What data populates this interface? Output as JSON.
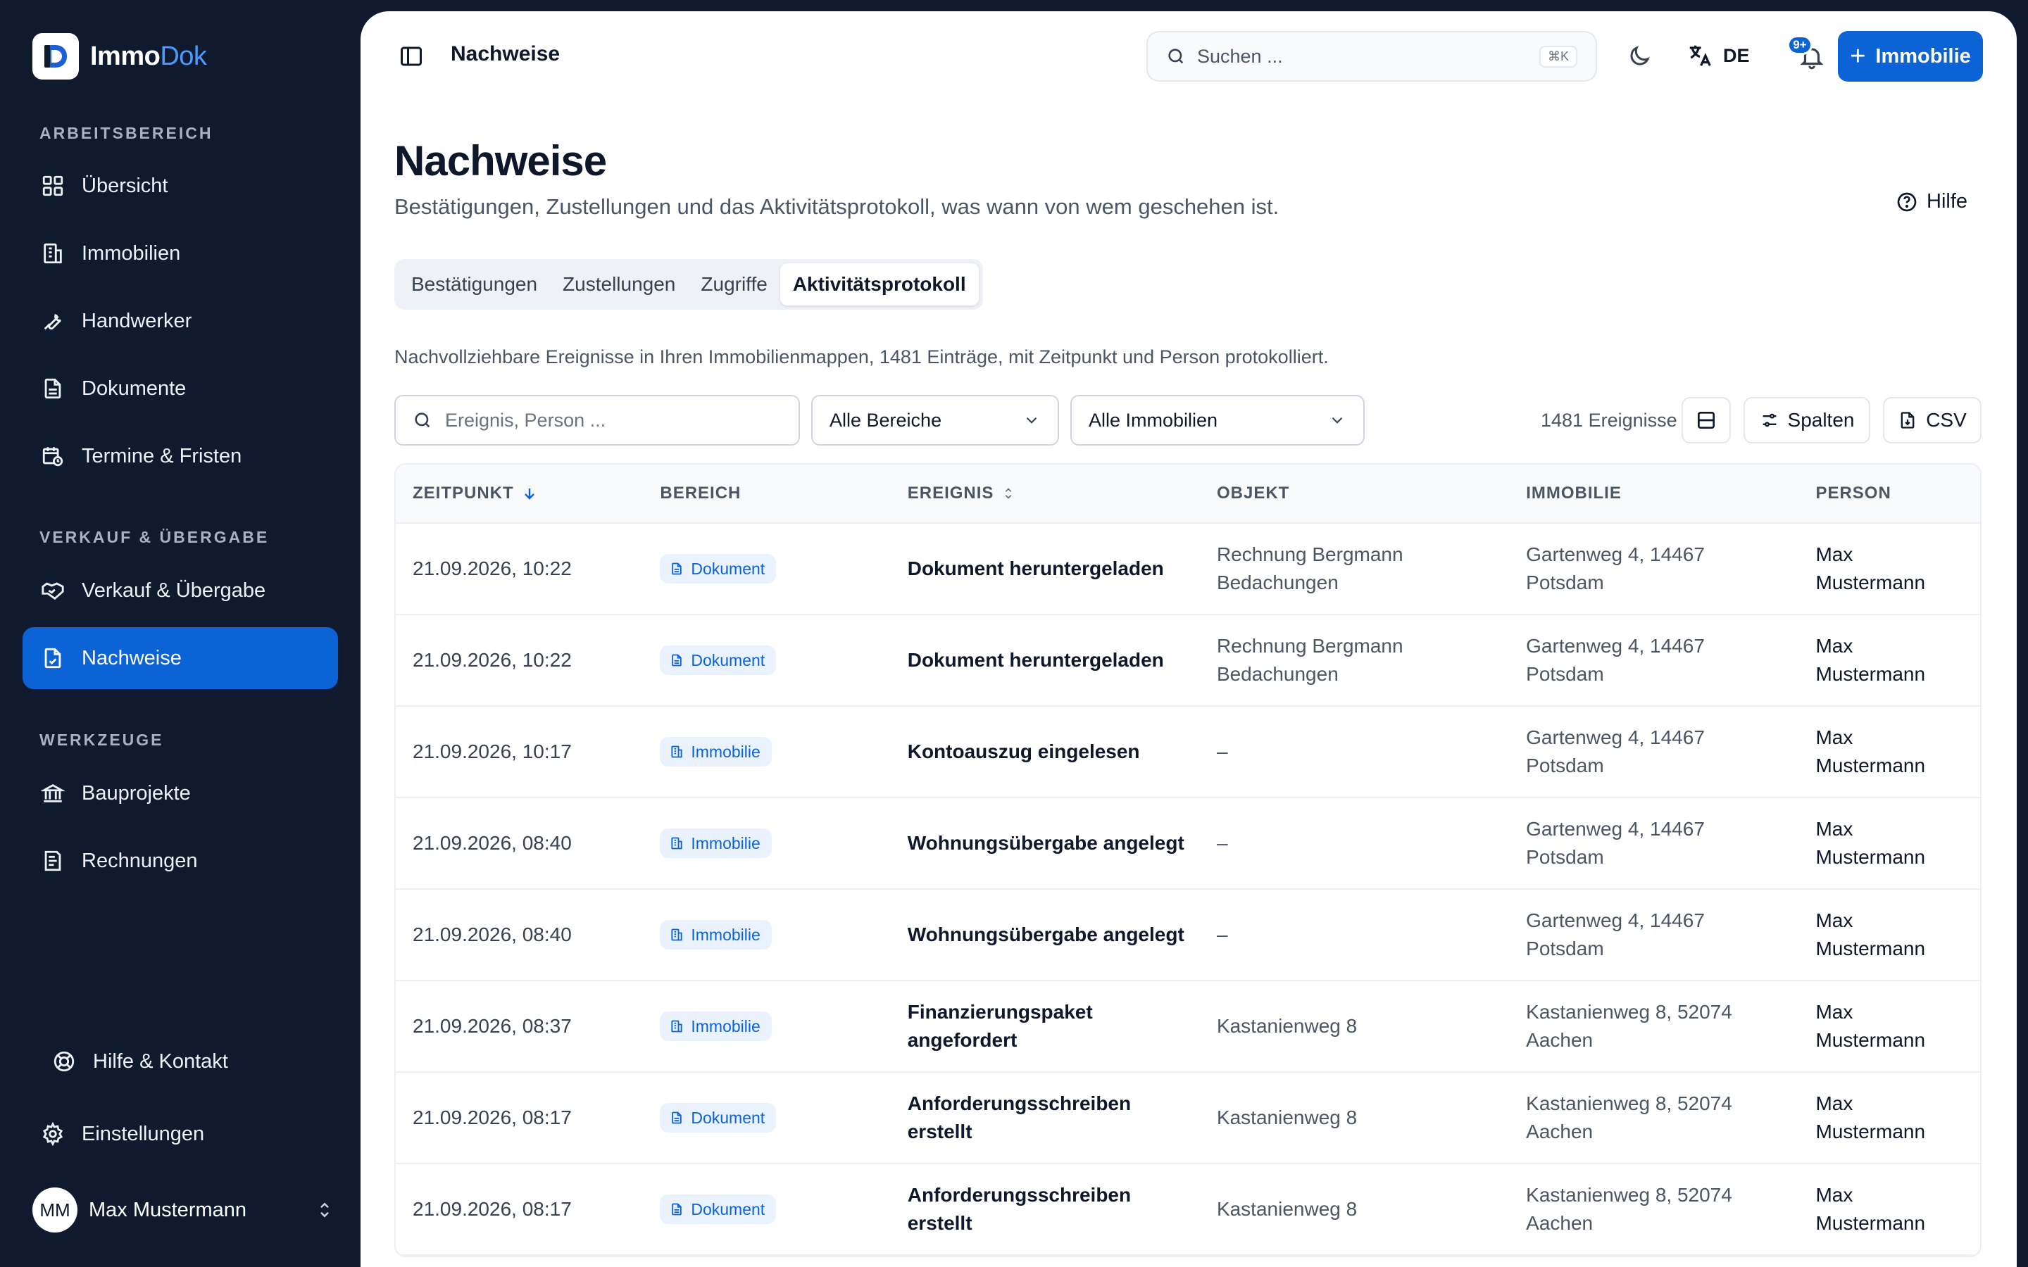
{
  "brand": {
    "name_part1": "Immo",
    "name_part2": "Dok"
  },
  "sidebar": {
    "sections": [
      {
        "label": "ARBEITSBEREICH"
      },
      {
        "label": "VERKAUF & ÜBERGABE"
      },
      {
        "label": "WERKZEUGE"
      }
    ],
    "items": [
      {
        "label": "Übersicht",
        "icon": "grid-icon"
      },
      {
        "label": "Immobilien",
        "icon": "building-icon"
      },
      {
        "label": "Handwerker",
        "icon": "wrench-icon"
      },
      {
        "label": "Dokumente",
        "icon": "document-icon"
      },
      {
        "label": "Termine & Fristen",
        "icon": "calendar-clock-icon"
      },
      {
        "label": "Verkauf & Übergabe",
        "icon": "handshake-icon"
      },
      {
        "label": "Nachweise",
        "icon": "file-check-icon",
        "active": true
      },
      {
        "label": "Bauprojekte",
        "icon": "bank-icon"
      },
      {
        "label": "Rechnungen",
        "icon": "receipt-icon"
      }
    ],
    "help_label": "Hilfe & Kontakt",
    "settings_label": "Einstellungen",
    "user": {
      "initials": "MM",
      "name": "Max Mustermann"
    }
  },
  "topbar": {
    "title": "Nachweise",
    "search_placeholder": "Suchen ...",
    "search_shortcut": "⌘K",
    "language": "DE",
    "notification_badge": "9+",
    "primary_button": "Immobilie"
  },
  "page": {
    "title": "Nachweise",
    "subtitle": "Bestätigungen, Zustellungen und das Aktivitätsprotokoll, was wann von wem geschehen ist.",
    "help": "Hilfe",
    "tabs": [
      {
        "label": "Bestätigungen"
      },
      {
        "label": "Zustellungen"
      },
      {
        "label": "Zugriffe"
      },
      {
        "label": "Aktivitätsprotokoll",
        "active": true
      }
    ],
    "description": "Nachvollziehbare Ereignisse in Ihren Immobilienmappen, 1481 Einträge, mit Zeitpunkt und Person protokolliert."
  },
  "filters": {
    "search_placeholder": "Ereignis, Person ...",
    "area_select": "Alle Bereiche",
    "property_select": "Alle Immobilien",
    "count": "1481 Ereignisse",
    "columns_button": "Spalten",
    "csv_button": "CSV"
  },
  "table": {
    "headers": [
      "ZEITPUNKT",
      "BEREICH",
      "EREIGNIS",
      "OBJEKT",
      "IMMOBILIE",
      "PERSON"
    ],
    "rows": [
      {
        "time": "21.09.2026, 10:22",
        "area": "Dokument",
        "event": "Dokument heruntergeladen",
        "object": "Rechnung Bergmann Bedachungen",
        "property": "Gartenweg 4, 14467 Potsdam",
        "person": "Max Mustermann"
      },
      {
        "time": "21.09.2026, 10:22",
        "area": "Dokument",
        "event": "Dokument heruntergeladen",
        "object": "Rechnung Bergmann Bedachungen",
        "property": "Gartenweg 4, 14467 Potsdam",
        "person": "Max Mustermann"
      },
      {
        "time": "21.09.2026, 10:17",
        "area": "Immobilie",
        "event": "Kontoauszug eingelesen",
        "object": "–",
        "property": "Gartenweg 4, 14467 Potsdam",
        "person": "Max Mustermann"
      },
      {
        "time": "21.09.2026, 08:40",
        "area": "Immobilie",
        "event": "Wohnungsübergabe angelegt",
        "object": "–",
        "property": "Gartenweg 4, 14467 Potsdam",
        "person": "Max Mustermann"
      },
      {
        "time": "21.09.2026, 08:40",
        "area": "Immobilie",
        "event": "Wohnungsübergabe angelegt",
        "object": "–",
        "property": "Gartenweg 4, 14467 Potsdam",
        "person": "Max Mustermann"
      },
      {
        "time": "21.09.2026, 08:37",
        "area": "Immobilie",
        "event": "Finanzierungspaket angefordert",
        "object": "Kastanienweg 8",
        "property": "Kastanienweg 8, 52074 Aachen",
        "person": "Max Mustermann"
      },
      {
        "time": "21.09.2026, 08:17",
        "area": "Dokument",
        "event": "Anforderungsschreiben erstellt",
        "object": "Kastanienweg 8",
        "property": "Kastanienweg 8, 52074 Aachen",
        "person": "Max Mustermann"
      },
      {
        "time": "21.09.2026, 08:17",
        "area": "Dokument",
        "event": "Anforderungsschreiben erstellt",
        "object": "Kastanienweg 8",
        "property": "Kastanienweg 8, 52074 Aachen",
        "person": "Max Mustermann"
      }
    ]
  },
  "colors": {
    "sidebar_bg": "#0f1a2e",
    "accent": "#0b63d6",
    "badge_bg": "#eaf2fe"
  }
}
